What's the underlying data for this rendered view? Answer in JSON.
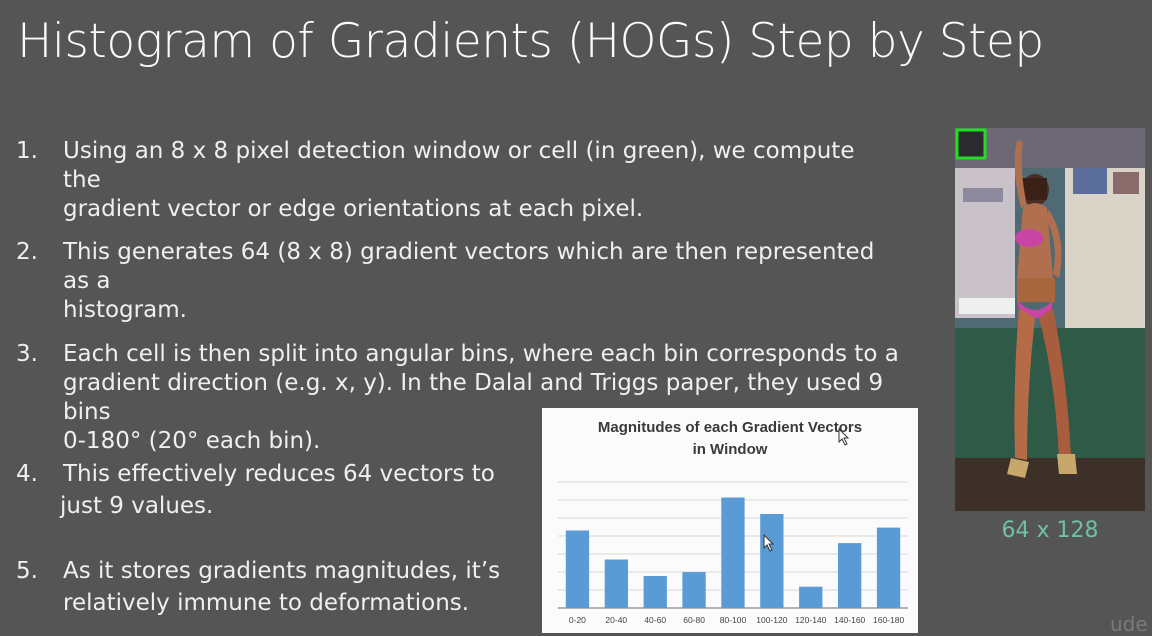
{
  "slide": {
    "title": "Histogram of Gradients (HOGs) Step by Step",
    "items": [
      {
        "num": "1.",
        "line1": "Using an 8 x 8 pixel detection window or cell (in green), we compute the",
        "line2": "gradient vector or edge orientations at each pixel."
      },
      {
        "num": "2.",
        "line1": "This generates 64 (8 x 8) gradient vectors which are then represented as a",
        "line2": "histogram."
      },
      {
        "num": "3.",
        "line1": "Each cell is then split into angular bins, where each bin corresponds to a",
        "line2": "gradient direction (e.g. x, y). In the Dalal and Triggs paper, they used 9 bins",
        "line3": "0-180° (20° each bin)."
      },
      {
        "num": "4.",
        "line1": "This effectively reduces 64 vectors to",
        "line2": "just 9 values."
      },
      {
        "num": "5.",
        "line1": "As it stores gradients magnitudes, it’s",
        "line2": "relatively immune to deformations."
      }
    ],
    "image_caption": "64 x 128",
    "watermark": "ude"
  },
  "colors": {
    "background": "#555556",
    "bar": "#5b9bd5",
    "caption": "#6fc1a0",
    "cell_box": "#22dd22"
  },
  "chart_data": {
    "type": "bar",
    "title_line1": "Magnitudes of each Gradient Vectors",
    "title_line2": "in Window",
    "categories": [
      "0-20",
      "20-40",
      "40-60",
      "60-80",
      "80-100",
      "100-120",
      "120-140",
      "140-160",
      "160-180"
    ],
    "values": [
      80,
      50,
      33,
      37,
      114,
      97,
      22,
      67,
      83
    ],
    "ylim": [
      0,
      130
    ],
    "grid": true
  }
}
